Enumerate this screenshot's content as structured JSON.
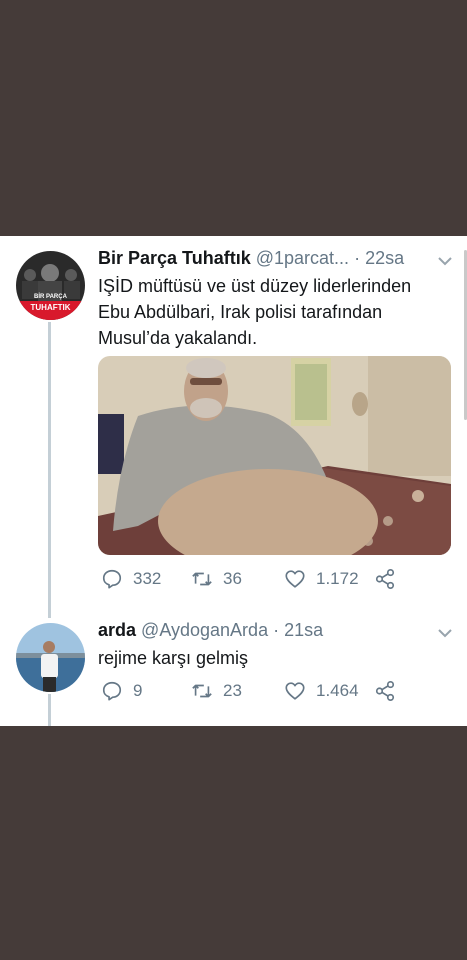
{
  "tweet1": {
    "display_name": "Bir Parça Tuhaftık",
    "handle": "@1parcat...",
    "separator": "·",
    "time": "22sa",
    "text_lines": [
      "IŞİD müftüsü ve üst düzey liderlerinden",
      "Ebu Abdülbari, Irak polisi tarafından",
      "Musul’da yakalandı."
    ],
    "avatar_text": [
      "BİR PARÇA",
      "TUHAFTIK"
    ],
    "replies": "332",
    "retweets": "36",
    "likes": "1.172"
  },
  "tweet2": {
    "display_name": "arda",
    "handle": "@AydoganArda",
    "separator": "·",
    "time": "21sa",
    "text": "rejime karşı gelmiş",
    "replies": "9",
    "retweets": "23",
    "likes": "1.464"
  },
  "icons": {
    "reply": "reply-icon",
    "retweet": "retweet-icon",
    "like": "heart-icon",
    "share": "share-icon",
    "menu": "chevron-down-icon"
  },
  "colors": {
    "background": "#453b39",
    "card": "#ffffff",
    "text": "#14171a",
    "muted": "#657786",
    "thread_line": "#c4cfd6"
  }
}
